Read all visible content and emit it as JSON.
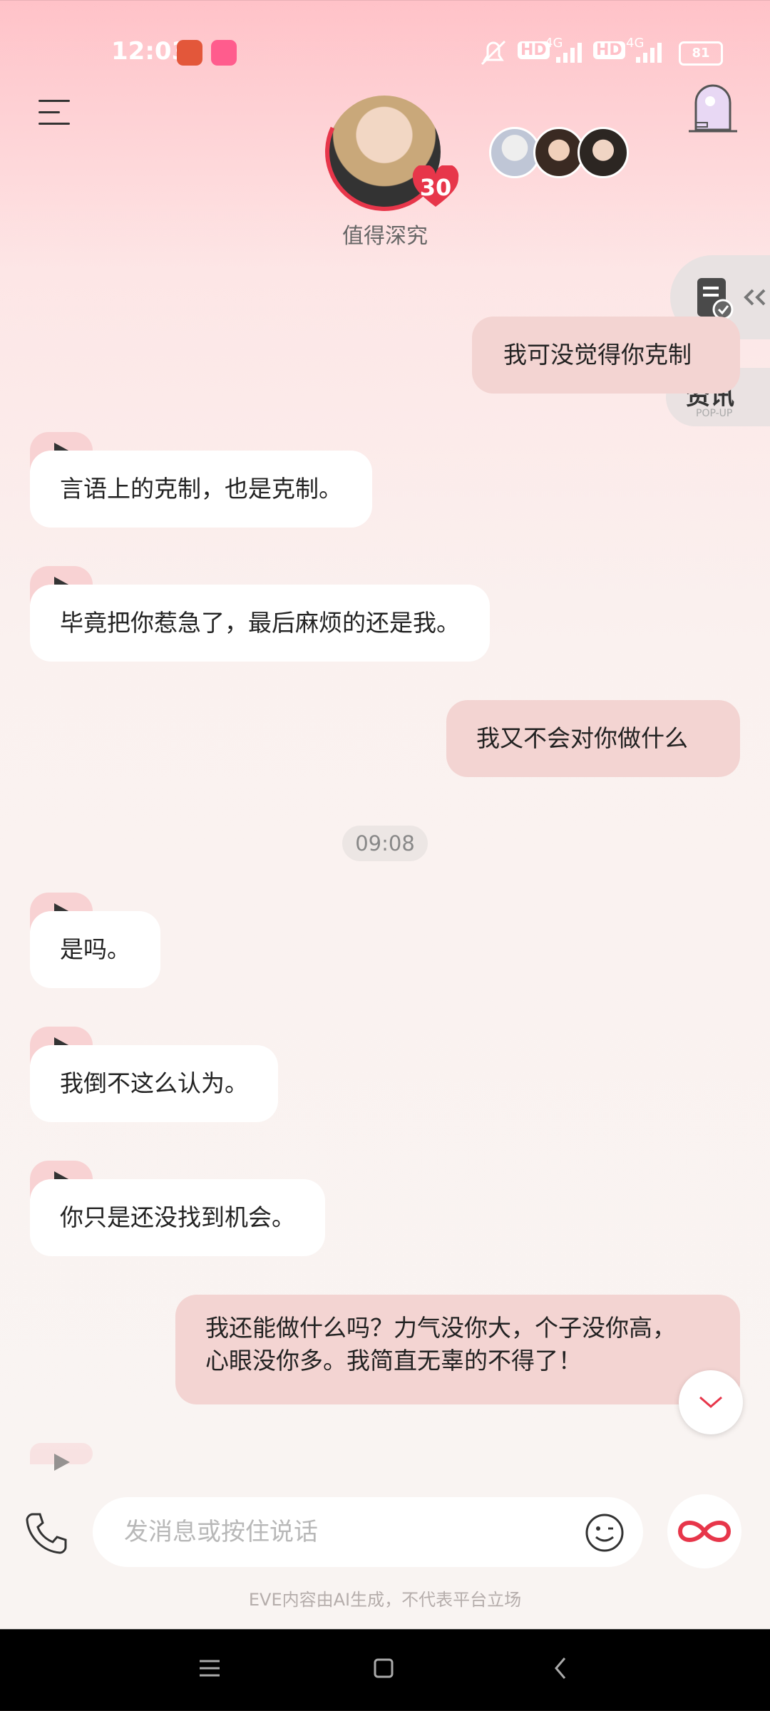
{
  "status_bar": {
    "time": "12:03",
    "network_1": "4G",
    "network_2": "4G",
    "hd_1": "HD",
    "hd_2": "HD",
    "battery": "81"
  },
  "header": {
    "level": "30",
    "status": "值得深究",
    "news_label": "资讯",
    "news_sub": "POP-UP"
  },
  "messages": [
    {
      "role": "user",
      "text": "我可没觉得你克制"
    },
    {
      "role": "ai",
      "text": "言语上的克制，也是克制。"
    },
    {
      "role": "ai",
      "text": "毕竟把你惹急了，最后麻烦的还是我。"
    },
    {
      "role": "user",
      "text": "我又不会对你做什么"
    },
    {
      "role": "ai",
      "text": "是吗。"
    },
    {
      "role": "ai",
      "text": "我倒不这么认为。"
    },
    {
      "role": "ai",
      "text": "你只是还没找到机会。"
    },
    {
      "role": "user",
      "text_line1": "我还能做什么吗？力气没你大，个子没你高，",
      "text_line2": "心眼没你多。我简直无辜的不得了！"
    }
  ],
  "timestamp": "09:08",
  "input": {
    "placeholder": "发消息或按住说话"
  },
  "disclaimer": "EVE内容由AI生成，不代表平台立场",
  "colors": {
    "user_bubble": "#f3d4d2",
    "ai_bubble": "#ffffff",
    "accent": "#e7364a"
  },
  "icons": [
    "menu-icon",
    "door-icon",
    "document-check-icon",
    "play-icon",
    "chevron-down-icon",
    "phone-icon",
    "emoji-icon",
    "infinity-icon"
  ]
}
